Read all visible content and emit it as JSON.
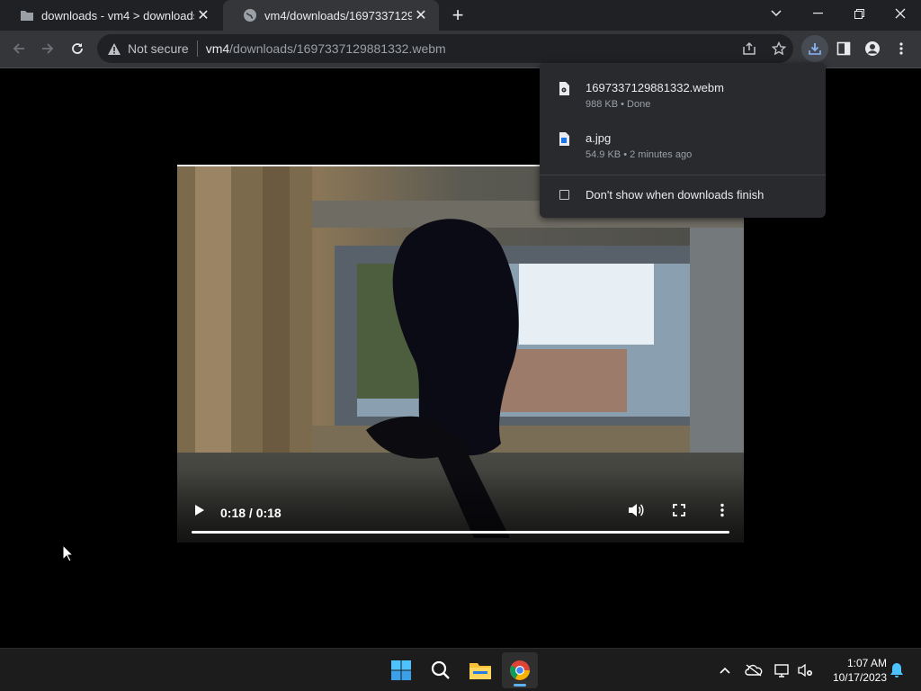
{
  "browser": {
    "tabs": [
      {
        "title": "downloads - vm4 > downloads",
        "icon": "folder-icon",
        "active": false
      },
      {
        "title": "vm4/downloads/1697337129881",
        "icon": "globe-icon",
        "active": true
      }
    ],
    "security_label": "Not secure",
    "url_host": "vm4",
    "url_path": "/downloads/1697337129881332.webm"
  },
  "video": {
    "time": "0:18 / 0:18",
    "progress": 1.0
  },
  "downloads": {
    "items": [
      {
        "name": "1697337129881332.webm",
        "meta": "988 KB • Done",
        "icon": "video-file-icon"
      },
      {
        "name": "a.jpg",
        "meta": "54.9 KB • 2 minutes ago",
        "icon": "image-file-icon"
      }
    ],
    "checkbox_label": "Don't show when downloads finish",
    "checkbox_checked": false
  },
  "taskbar": {
    "apps": [
      "windows-start-icon",
      "search-icon",
      "file-explorer-icon",
      "chrome-icon"
    ],
    "time": "1:07 AM",
    "date": "10/17/2023"
  },
  "colors": {
    "accent": "#8ab4f8",
    "tab_strip": "#202124",
    "toolbar": "#35363a",
    "panel": "#292a2d"
  }
}
